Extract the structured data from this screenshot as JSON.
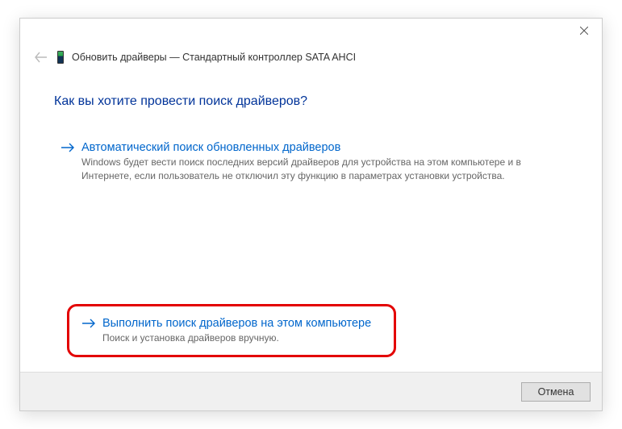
{
  "header": {
    "title": "Обновить драйверы — Стандартный контроллер SATA AHCI"
  },
  "heading": "Как вы хотите провести поиск драйверов?",
  "options": [
    {
      "title": "Автоматический поиск обновленных драйверов",
      "desc": "Windows будет вести поиск последних версий драйверов для устройства на этом компьютере и в Интернете, если пользователь не отключил эту функцию в параметрах установки устройства."
    },
    {
      "title": "Выполнить поиск драйверов на этом компьютере",
      "desc": "Поиск и установка драйверов вручную."
    }
  ],
  "footer": {
    "cancel": "Отмена"
  }
}
